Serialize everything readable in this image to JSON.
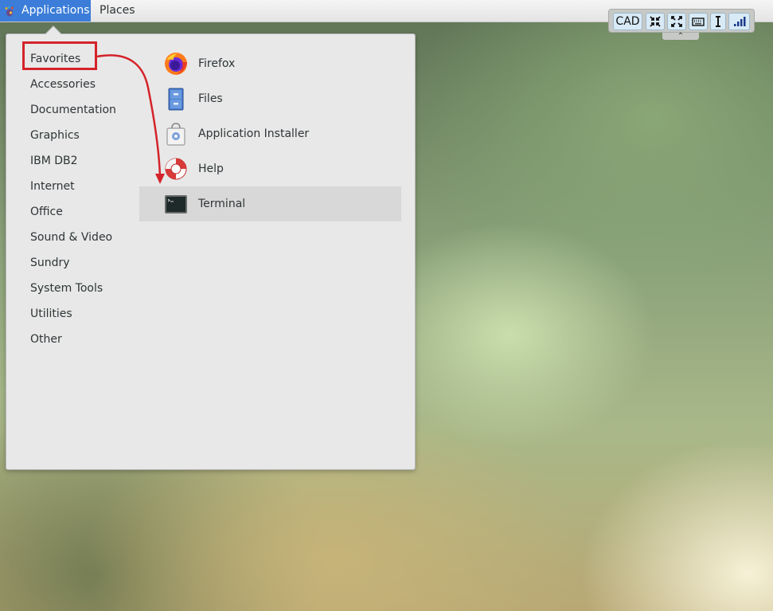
{
  "panel": {
    "applications_label": "Applications",
    "places_label": "Places",
    "applications_active_color": "#3b7dd8"
  },
  "vnc_toolbar": {
    "cad_label": "CAD",
    "buttons": [
      "CAD",
      "exit-fullscreen-icon",
      "fullscreen-icon",
      "keyboard-icon",
      "text-cursor-icon",
      "signal-bars-icon"
    ],
    "handle_glyph": "⌃"
  },
  "menu": {
    "categories": [
      "Favorites",
      "Accessories",
      "Documentation",
      "Graphics",
      "IBM DB2",
      "Internet",
      "Office",
      "Sound & Video",
      "Sundry",
      "System Tools",
      "Utilities",
      "Other"
    ],
    "selected_category": "Favorites",
    "apps": [
      {
        "label": "Firefox",
        "icon": "firefox-icon"
      },
      {
        "label": "Files",
        "icon": "files-cabinet-icon"
      },
      {
        "label": "Application Installer",
        "icon": "app-installer-icon"
      },
      {
        "label": "Help",
        "icon": "lifebuoy-help-icon"
      },
      {
        "label": "Terminal",
        "icon": "terminal-icon"
      }
    ],
    "highlighted_app": "Terminal"
  },
  "annotation": {
    "color": "#d4232a",
    "icon": "red-arrow-annotation"
  }
}
